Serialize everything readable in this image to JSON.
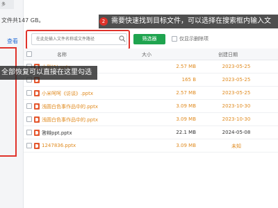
{
  "summary": {
    "text": "文件共147 GB。"
  },
  "left_pane": {
    "tab_label": "多",
    "view_label": "查看"
  },
  "callouts": {
    "top_badge": "2",
    "top_text": "需要快速找到目标文件，可以选择在搜索框内输入文",
    "left_text": "全部恢复可以直接在这里勾选"
  },
  "search": {
    "placeholder": "在此处输入文件名称或文件路径"
  },
  "filter": {
    "button_label": "筛选器",
    "deleted_only_label": "仅显示删除项"
  },
  "table": {
    "headers": {
      "name": "名称",
      "size": "大小",
      "date": "创建日期"
    },
    "rows": [
      {
        "name": "小型(1).pptx",
        "size": "2.57 MB",
        "date": "2023-05-25",
        "tone": "orange"
      },
      {
        "name": "",
        "size": "165 B",
        "date": "2023-05-25",
        "tone": "orange"
      },
      {
        "name": "小米呵呵《访谈》.pptx",
        "size": "2.57 MB",
        "date": "2023-05-25",
        "tone": "orange"
      },
      {
        "name": "浅圆白色事作品中的.pptx",
        "size": "3.09 MB",
        "date": "2023-10-30",
        "tone": "orange"
      },
      {
        "name": "浅圆白色事作品中的.pptx",
        "size": "3.09 MB",
        "date": "2023-10-30",
        "tone": "orange"
      },
      {
        "name": "答辩ppt.pptx",
        "size": "22.1 MB",
        "date": "2024-05-08",
        "tone": "dark"
      },
      {
        "name": "1247836.pptx",
        "size": "3.09 MB",
        "date": "未知",
        "tone": "orange"
      }
    ]
  }
}
